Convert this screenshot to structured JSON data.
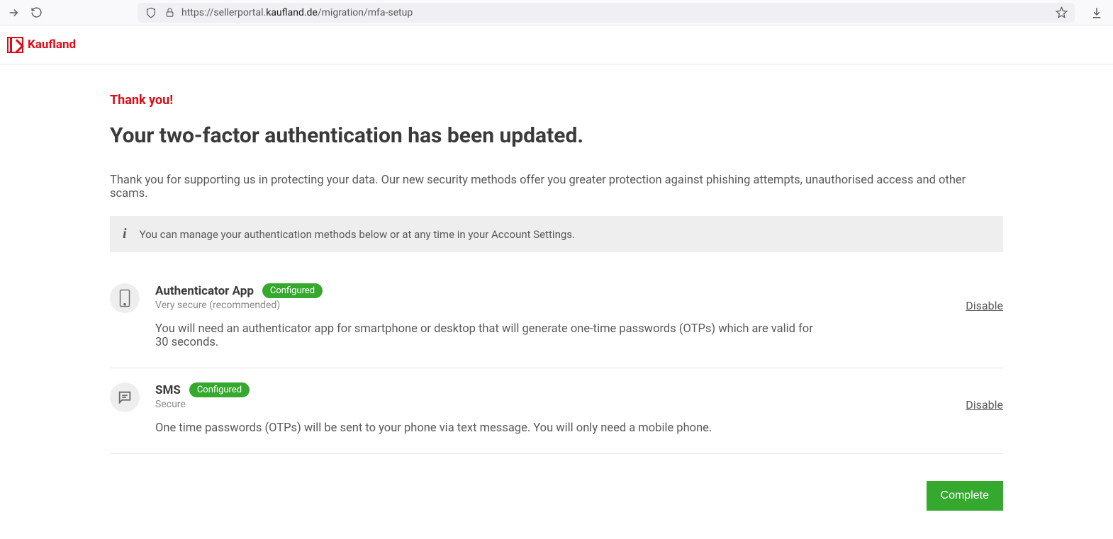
{
  "browser": {
    "url_pre": "https://sellerportal.",
    "url_domain": "kaufland.de",
    "url_post": "/migration/mfa-setup"
  },
  "brand": {
    "name": "Kaufland"
  },
  "page": {
    "thank_you": "Thank you!",
    "headline": "Your two-factor authentication has been updated.",
    "description": "Thank you for supporting us in protecting your data. Our new security methods offer you greater protection against phishing attempts, unauthorised access and other scams.",
    "info_notice": "You can manage your authentication methods below or at any time in your Account Settings."
  },
  "methods": [
    {
      "title": "Authenticator App",
      "status": "Configured",
      "subtitle": "Very secure (recommended)",
      "description": "You will need an authenticator app for smartphone or desktop that will generate one-time passwords (OTPs) which are valid for 30 seconds.",
      "action": "Disable"
    },
    {
      "title": "SMS",
      "status": "Configured",
      "subtitle": "Secure",
      "description": "One time passwords (OTPs) will be sent to your phone via text message. You will only need a mobile phone.",
      "action": "Disable"
    }
  ],
  "buttons": {
    "complete": "Complete"
  }
}
